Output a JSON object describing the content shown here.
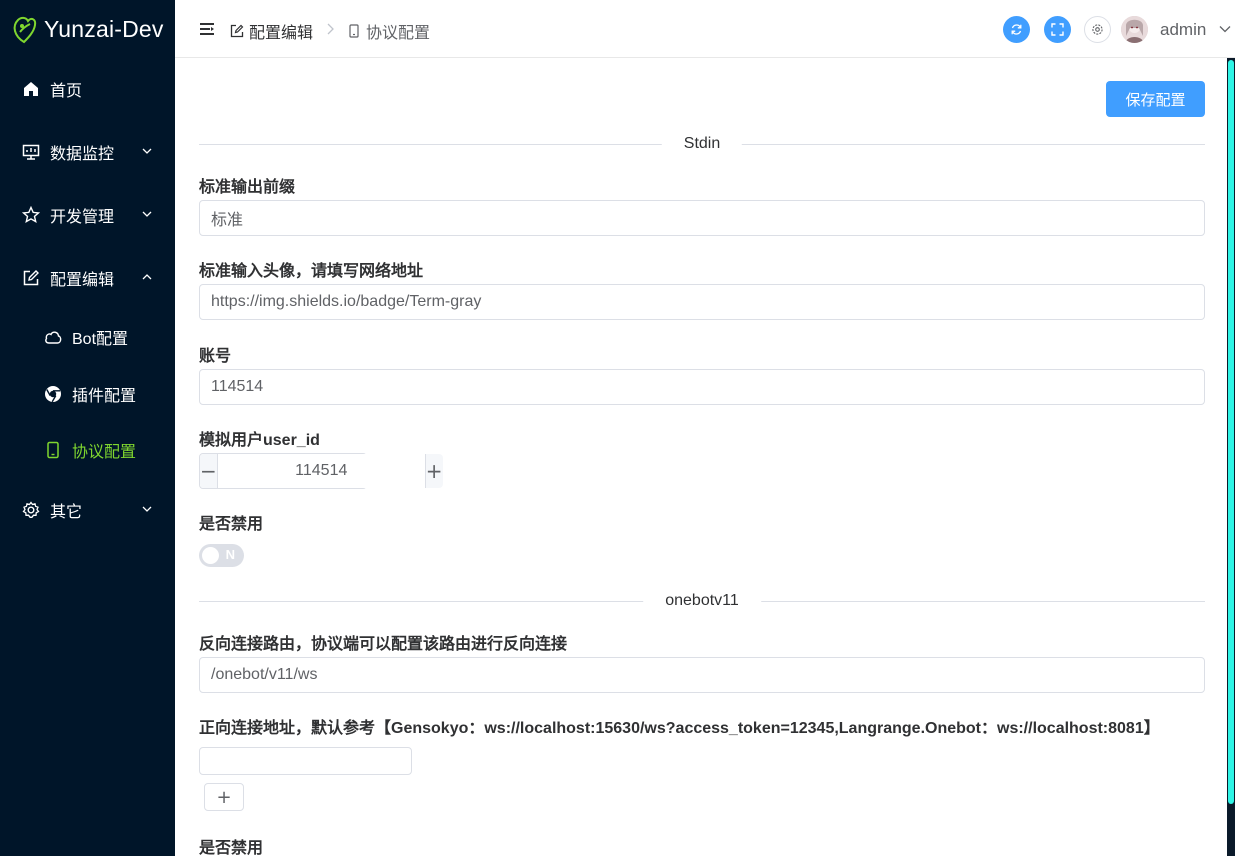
{
  "app": {
    "name": "Yunzai-Dev"
  },
  "sidebar": {
    "items": [
      {
        "label": "首页",
        "icon": "home-icon"
      },
      {
        "label": "数据监控",
        "icon": "monitor-icon",
        "expanded": false
      },
      {
        "label": "开发管理",
        "icon": "star-icon",
        "expanded": false
      },
      {
        "label": "配置编辑",
        "icon": "edit-icon",
        "expanded": true
      },
      {
        "label": "Bot配置",
        "icon": "cloud-icon"
      },
      {
        "label": "插件配置",
        "icon": "chrome-icon"
      },
      {
        "label": "协议配置",
        "icon": "phone-icon",
        "active": true
      },
      {
        "label": "其它",
        "icon": "gear-icon",
        "expanded": false
      }
    ]
  },
  "header": {
    "breadcrumb": [
      "配置编辑",
      "协议配置"
    ],
    "username": "admin"
  },
  "main": {
    "save_label": "保存配置",
    "sections": {
      "stdin": "Stdin",
      "onebot": "onebotv11"
    },
    "fields": {
      "prefix_label": "标准输出前缀",
      "prefix_value": "标准",
      "avatar_label": "标准输入头像，请填写网络地址",
      "avatar_value": "https://img.shields.io/badge/Term-gray",
      "account_label": "账号",
      "account_value": "114514",
      "user_id_label": "模拟用户user_id",
      "user_id_value": "114514",
      "disable_label": "是否禁用",
      "disable_state": "N",
      "reverse_label": "反向连接路由，协议端可以配置该路由进行反向连接",
      "reverse_value": "/onebot/v11/ws",
      "forward_label": "正向连接地址，默认参考【Gensokyo：ws://localhost:15630/ws?access_token=12345,Langrange.Onebot：ws://localhost:8081】",
      "forward_value": "",
      "disable2_label": "是否禁用"
    }
  },
  "colors": {
    "sidebar_bg": "#001529",
    "accent": "#409eff",
    "active": "#7fd62f"
  }
}
